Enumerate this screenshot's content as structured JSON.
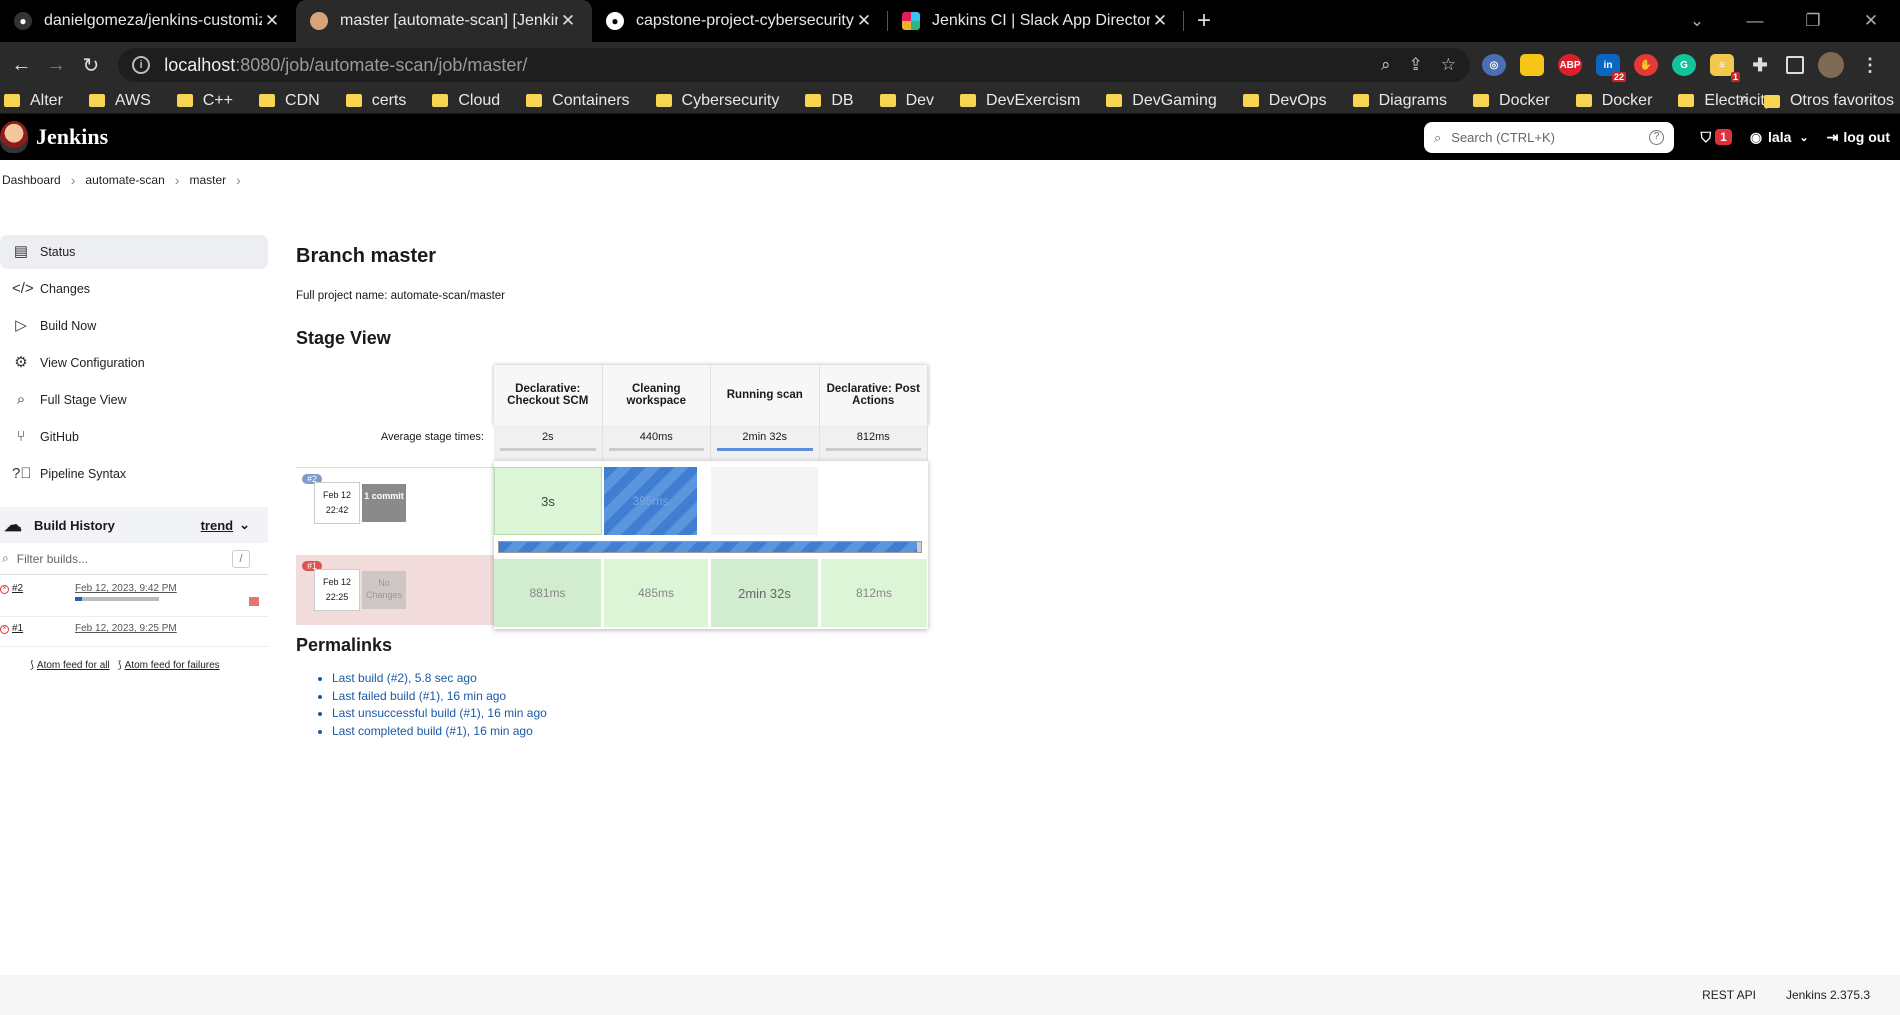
{
  "browser": {
    "tabs": [
      {
        "title": "danielgomeza/jenkins-customize",
        "icon": "github-icon"
      },
      {
        "title": "master [automate-scan] [Jenkins]",
        "icon": "jenkins-icon"
      },
      {
        "title": "capstone-project-cybersecurity/a",
        "icon": "github-icon"
      },
      {
        "title": "Jenkins CI | Slack App Directory",
        "icon": "slack-icon"
      }
    ],
    "url_host": "localhost",
    "url_path": ":8080/job/automate-scan/job/master/",
    "ext_badge_linkedin": "22",
    "ext_badge_notes": "1",
    "ext_abp": "ABP",
    "bookmarks": [
      "Alter",
      "AWS",
      "C++",
      "CDN",
      "certs",
      "Cloud",
      "Containers",
      "Cybersecurity",
      "DB",
      "Dev",
      "DevExercism",
      "DevGaming",
      "DevOps",
      "Diagrams",
      "Docker",
      "Docker",
      "Electricity"
    ],
    "bookmarks_more": "»",
    "other_bookmarks": "Otros favoritos"
  },
  "jenkins": {
    "logo": "Jenkins",
    "search_placeholder": "Search (CTRL+K)",
    "security_count": "1",
    "user": "lala",
    "logout": "log out",
    "breadcrumb": [
      "Dashboard",
      "automate-scan",
      "master"
    ],
    "sidebar": [
      {
        "label": "Status",
        "icon": "document-icon"
      },
      {
        "label": "Changes",
        "icon": "code-icon"
      },
      {
        "label": "Build Now",
        "icon": "play-icon"
      },
      {
        "label": "View Configuration",
        "icon": "gear-icon"
      },
      {
        "label": "Full Stage View",
        "icon": "search-icon"
      },
      {
        "label": "GitHub",
        "icon": "branch-icon"
      },
      {
        "label": "Pipeline Syntax",
        "icon": "help-icon"
      }
    ],
    "build_history": {
      "title": "Build History",
      "trend": "trend",
      "filter_placeholder": "Filter builds...",
      "filter_key": "/",
      "builds": [
        {
          "num": "#2",
          "date": "Feb 12, 2023, 9:42 PM",
          "progress": 0.08
        },
        {
          "num": "#1",
          "date": "Feb 12, 2023, 9:25 PM"
        }
      ],
      "feed_all": "Atom feed for all",
      "feed_failures": "Atom feed for failures"
    },
    "title": "Branch master",
    "full_name": "Full project name: automate-scan/master",
    "stage_view_title": "Stage View",
    "stage_view": {
      "stages": [
        "Declarative: Checkout SCM",
        "Cleaning workspace",
        "Running scan",
        "Declarative: Post Actions"
      ],
      "avg_label": "Average stage times:",
      "avg": [
        "2s",
        "440ms",
        "2min 32s",
        "812ms"
      ],
      "runs": [
        {
          "badge": "#2",
          "date": "Feb 12",
          "time": "22:42",
          "changes": "1 commit",
          "cells": [
            "3s",
            "395ms",
            "",
            ""
          ],
          "progress": 0.99
        },
        {
          "badge": "#1",
          "date": "Feb 12",
          "time": "22:25",
          "changes": "No Changes",
          "cells": [
            "881ms",
            "485ms",
            "2min 32s",
            "812ms"
          ]
        }
      ]
    },
    "permalinks_title": "Permalinks",
    "permalinks": [
      "Last build (#2), 5.8 sec ago",
      "Last failed build (#1), 16 min ago",
      "Last unsuccessful build (#1), 16 min ago",
      "Last completed build (#1), 16 min ago"
    ],
    "footer": {
      "rest": "REST API",
      "version": "Jenkins 2.375.3"
    }
  }
}
